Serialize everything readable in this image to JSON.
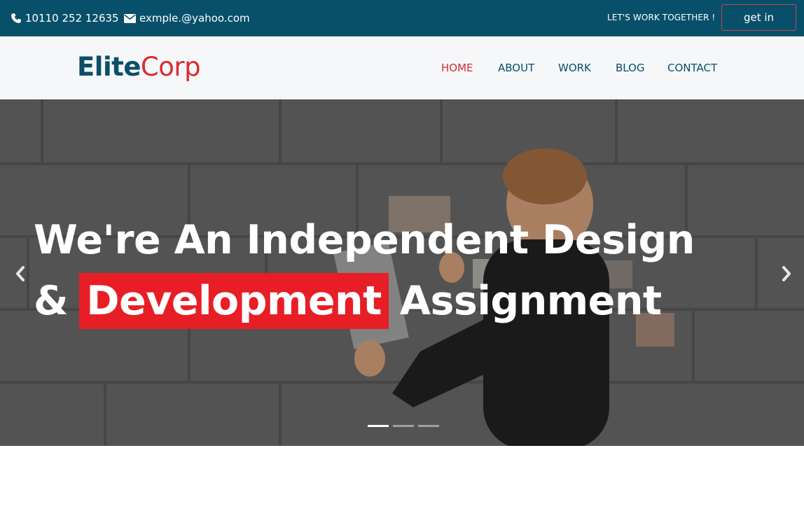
{
  "topbar": {
    "phone": "10110 252 12635",
    "email": "exmple.@yahoo.com",
    "cta_text": "LET'S WORK TOGETHER !",
    "button_label": "get in",
    "background": "#08506a"
  },
  "navbar": {
    "logo_part1": "Elite",
    "logo_part2": "Corp",
    "links": [
      {
        "label": "HOME",
        "active": true
      },
      {
        "label": "ABOUT",
        "active": false
      },
      {
        "label": "WORK",
        "active": false
      },
      {
        "label": "BLOG",
        "active": false
      },
      {
        "label": "CONTACT",
        "active": false
      }
    ],
    "active_color": "#d42b33",
    "link_color": "#0b4f69"
  },
  "hero": {
    "line1": "We're An Independent Design",
    "line2_prefix": "&",
    "line2_highlight": "Development",
    "line2_suffix": "Assignment",
    "highlight_color": "#e71e26",
    "slide_count": 3,
    "active_slide": 1,
    "icons": {
      "prev": "chevron-left-icon",
      "next": "chevron-right-icon",
      "phone": "phone-icon",
      "email": "envelope-icon"
    }
  }
}
